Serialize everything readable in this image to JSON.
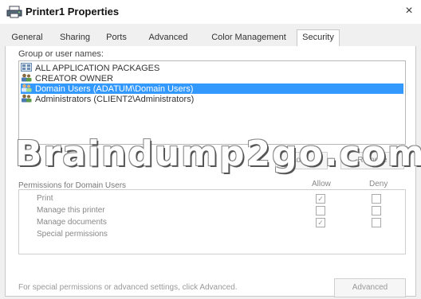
{
  "window": {
    "title": "Printer1 Properties",
    "close_glyph": "×"
  },
  "tabs": [
    {
      "label": "General"
    },
    {
      "label": "Sharing"
    },
    {
      "label": "Ports"
    },
    {
      "label": "Advanced"
    },
    {
      "label": "Color Management"
    },
    {
      "label": "Security"
    }
  ],
  "active_tab": "Security",
  "security": {
    "group_label": "Group or user names:",
    "users": [
      {
        "label": "ALL APPLICATION PACKAGES",
        "icon": "packages-icon"
      },
      {
        "label": "CREATOR OWNER",
        "icon": "users-icon"
      },
      {
        "label": "Domain Users (ADATUM\\Domain Users)",
        "icon": "users-icon",
        "selected": true
      },
      {
        "label": "Administrators (CLIENT2\\Administrators)",
        "icon": "users-icon"
      }
    ],
    "watermark": "Braindump2go.com",
    "add_label": "Add...",
    "remove_label": "Remove",
    "permissions_label": "Permissions for Domain Users",
    "allow_header": "Allow",
    "deny_header": "Deny",
    "permissions": [
      {
        "name": "Print",
        "allow": true,
        "deny": false
      },
      {
        "name": "Manage this printer",
        "allow": false,
        "deny": false
      },
      {
        "name": "Manage documents",
        "allow": true,
        "deny": false
      },
      {
        "name": "Special permissions",
        "allow": false,
        "deny": false
      }
    ],
    "footer_text": "For special permissions or advanced settings, click Advanced.",
    "advanced_label": "Advanced"
  },
  "colors": {
    "selection": "#3399ff",
    "panel": "#ffffff",
    "background": "#f0f0f0"
  }
}
